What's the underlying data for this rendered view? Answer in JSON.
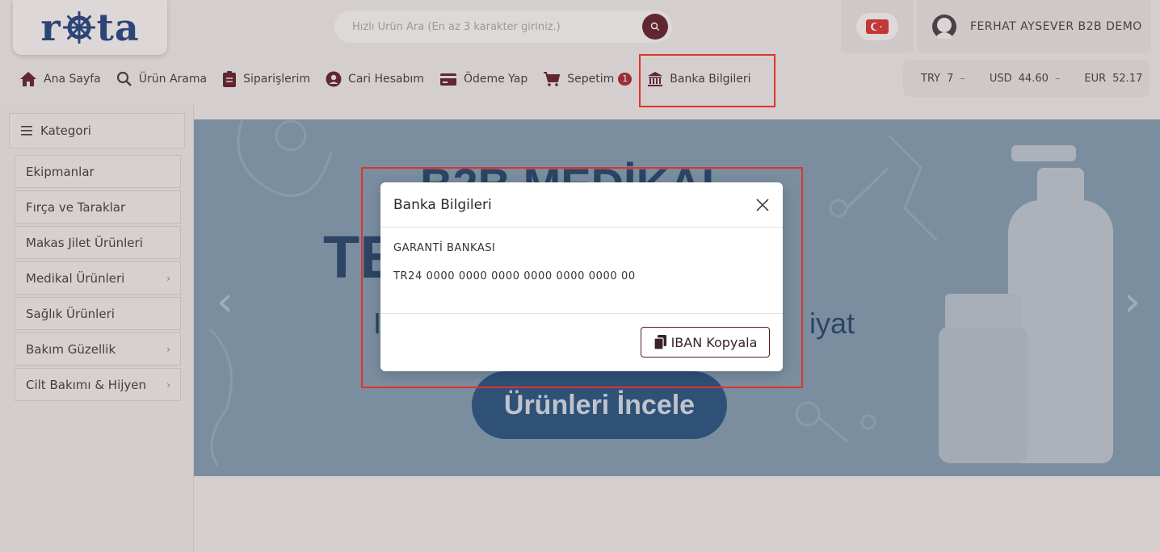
{
  "header": {
    "logo": "rota",
    "search_placeholder": "Hızlı Ürün Ara (En az 3 karakter giriniz.)",
    "user_name": "FERHAT AYSEVER B2B DEMO"
  },
  "nav": {
    "items": [
      {
        "label": "Ana Sayfa",
        "icon": "home-icon"
      },
      {
        "label": "Ürün Arama",
        "icon": "search-icon"
      },
      {
        "label": "Siparişlerim",
        "icon": "clipboard-icon"
      },
      {
        "label": "Cari Hesabım",
        "icon": "user-circle-icon"
      },
      {
        "label": "Ödeme Yap",
        "icon": "credit-card-icon"
      },
      {
        "label": "Sepetim",
        "icon": "cart-icon",
        "badge": "1"
      },
      {
        "label": "Banka Bilgileri",
        "icon": "bank-icon"
      }
    ]
  },
  "rates": [
    {
      "code": "TRY",
      "value": "7",
      "trend": "–"
    },
    {
      "code": "USD",
      "value": "44.60",
      "trend": "–"
    },
    {
      "code": "EUR",
      "value": "52.17"
    }
  ],
  "sidebar": {
    "title": "Kategori",
    "items": [
      {
        "label": "Ekipmanlar",
        "arrow": ""
      },
      {
        "label": "Fırça ve Taraklar",
        "arrow": ""
      },
      {
        "label": "Makas Jilet Ürünleri",
        "arrow": ""
      },
      {
        "label": "Medikal Ürünleri",
        "arrow": "›"
      },
      {
        "label": "Sağlık Ürünleri",
        "arrow": ""
      },
      {
        "label": "Bakım Güzellik",
        "arrow": "›"
      },
      {
        "label": "Cilt Bakımı & Hijyen",
        "arrow": "›"
      }
    ]
  },
  "banner": {
    "line1": "B2B MEDİKAL",
    "line2": "TE RMU",
    "line3_left": "I",
    "line3_right": "iyat",
    "button": "Ürünleri İncele",
    "prev": "‹",
    "next": "›"
  },
  "modal": {
    "title": "Banka Bilgileri",
    "bank_name": "GARANTİ BANKASI",
    "iban": "TR24 0000 0000 0000 0000 0000 0000 00",
    "copy_button": "IBAN Kopyala"
  },
  "colors": {
    "accent": "#5b1a26",
    "highlight": "#e0322b",
    "badge": "#a3242f"
  }
}
